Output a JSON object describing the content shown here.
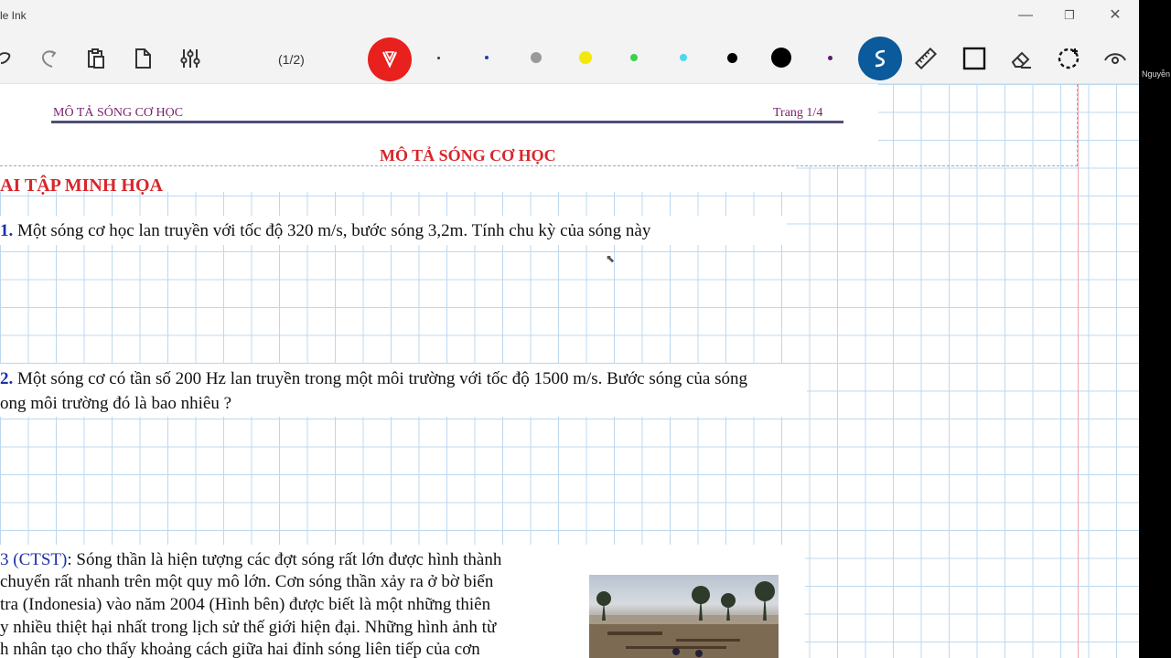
{
  "window": {
    "title": "le Ink",
    "controls": {
      "minimize": "—",
      "maximize": "❐",
      "close": "✕"
    }
  },
  "toolbar": {
    "page_indicator": "(1/2)",
    "icons": [
      "lasso-icon",
      "redo-icon",
      "clipboard-icon",
      "page-icon",
      "sliders-icon",
      "pen-icon",
      "shape-recognition-icon",
      "ruler-icon",
      "rectangle-icon",
      "eraser-icon",
      "selection-icon",
      "eye-icon"
    ],
    "active_pen_color": "#e8201e",
    "active_tool_color": "#0a5a9c",
    "colors": [
      "#3a3a3a",
      "#1d3fb0",
      "#9a9a9a",
      "#f2e80f",
      "#3dd24a",
      "#4fd6f0",
      "#000000",
      "#000000",
      "#5a1a78"
    ]
  },
  "document": {
    "header_left": "MÔ TẢ SÓNG CƠ HỌC",
    "header_right": "Trang 1/4",
    "title": "MÔ TẢ SÓNG CƠ HỌC",
    "section": "AI TẬP MINH HỌA",
    "q1_num": "1.",
    "q1_text": " Một sóng cơ học lan truyền với tốc độ 320 m/s, bước sóng 3,2m. Tính chu kỳ của sóng này",
    "q2_num": "2.",
    "q2_line1": " Một sóng cơ có tần số 200 Hz lan truyền trong một môi trường với tốc độ 1500 m/s. Bước sóng của sóng",
    "q2_line2": "ong môi trường đó là bao nhiêu ?",
    "q3_num": "3 (CTST)",
    "q3_line1": ": Sóng thần là hiện tượng các đợt sóng rất lớn được hình thành",
    "q3_line2": "chuyển rất nhanh trên một quy mô lớn. Cơn sóng thần xảy ra ở bờ biển",
    "q3_line3": "tra (Indonesia) vào năm 2004 (Hình bên) được biết là một những thiên",
    "q3_line4": "y nhiều thiệt hại nhất trong lịch sử thế giới hiện đại. Những hình ảnh từ",
    "q3_line5": "h nhân tạo cho thấy khoảng cách giữa hai đỉnh sóng liên tiếp của cơn"
  },
  "side_panel": {
    "name": "Nguyễn"
  }
}
